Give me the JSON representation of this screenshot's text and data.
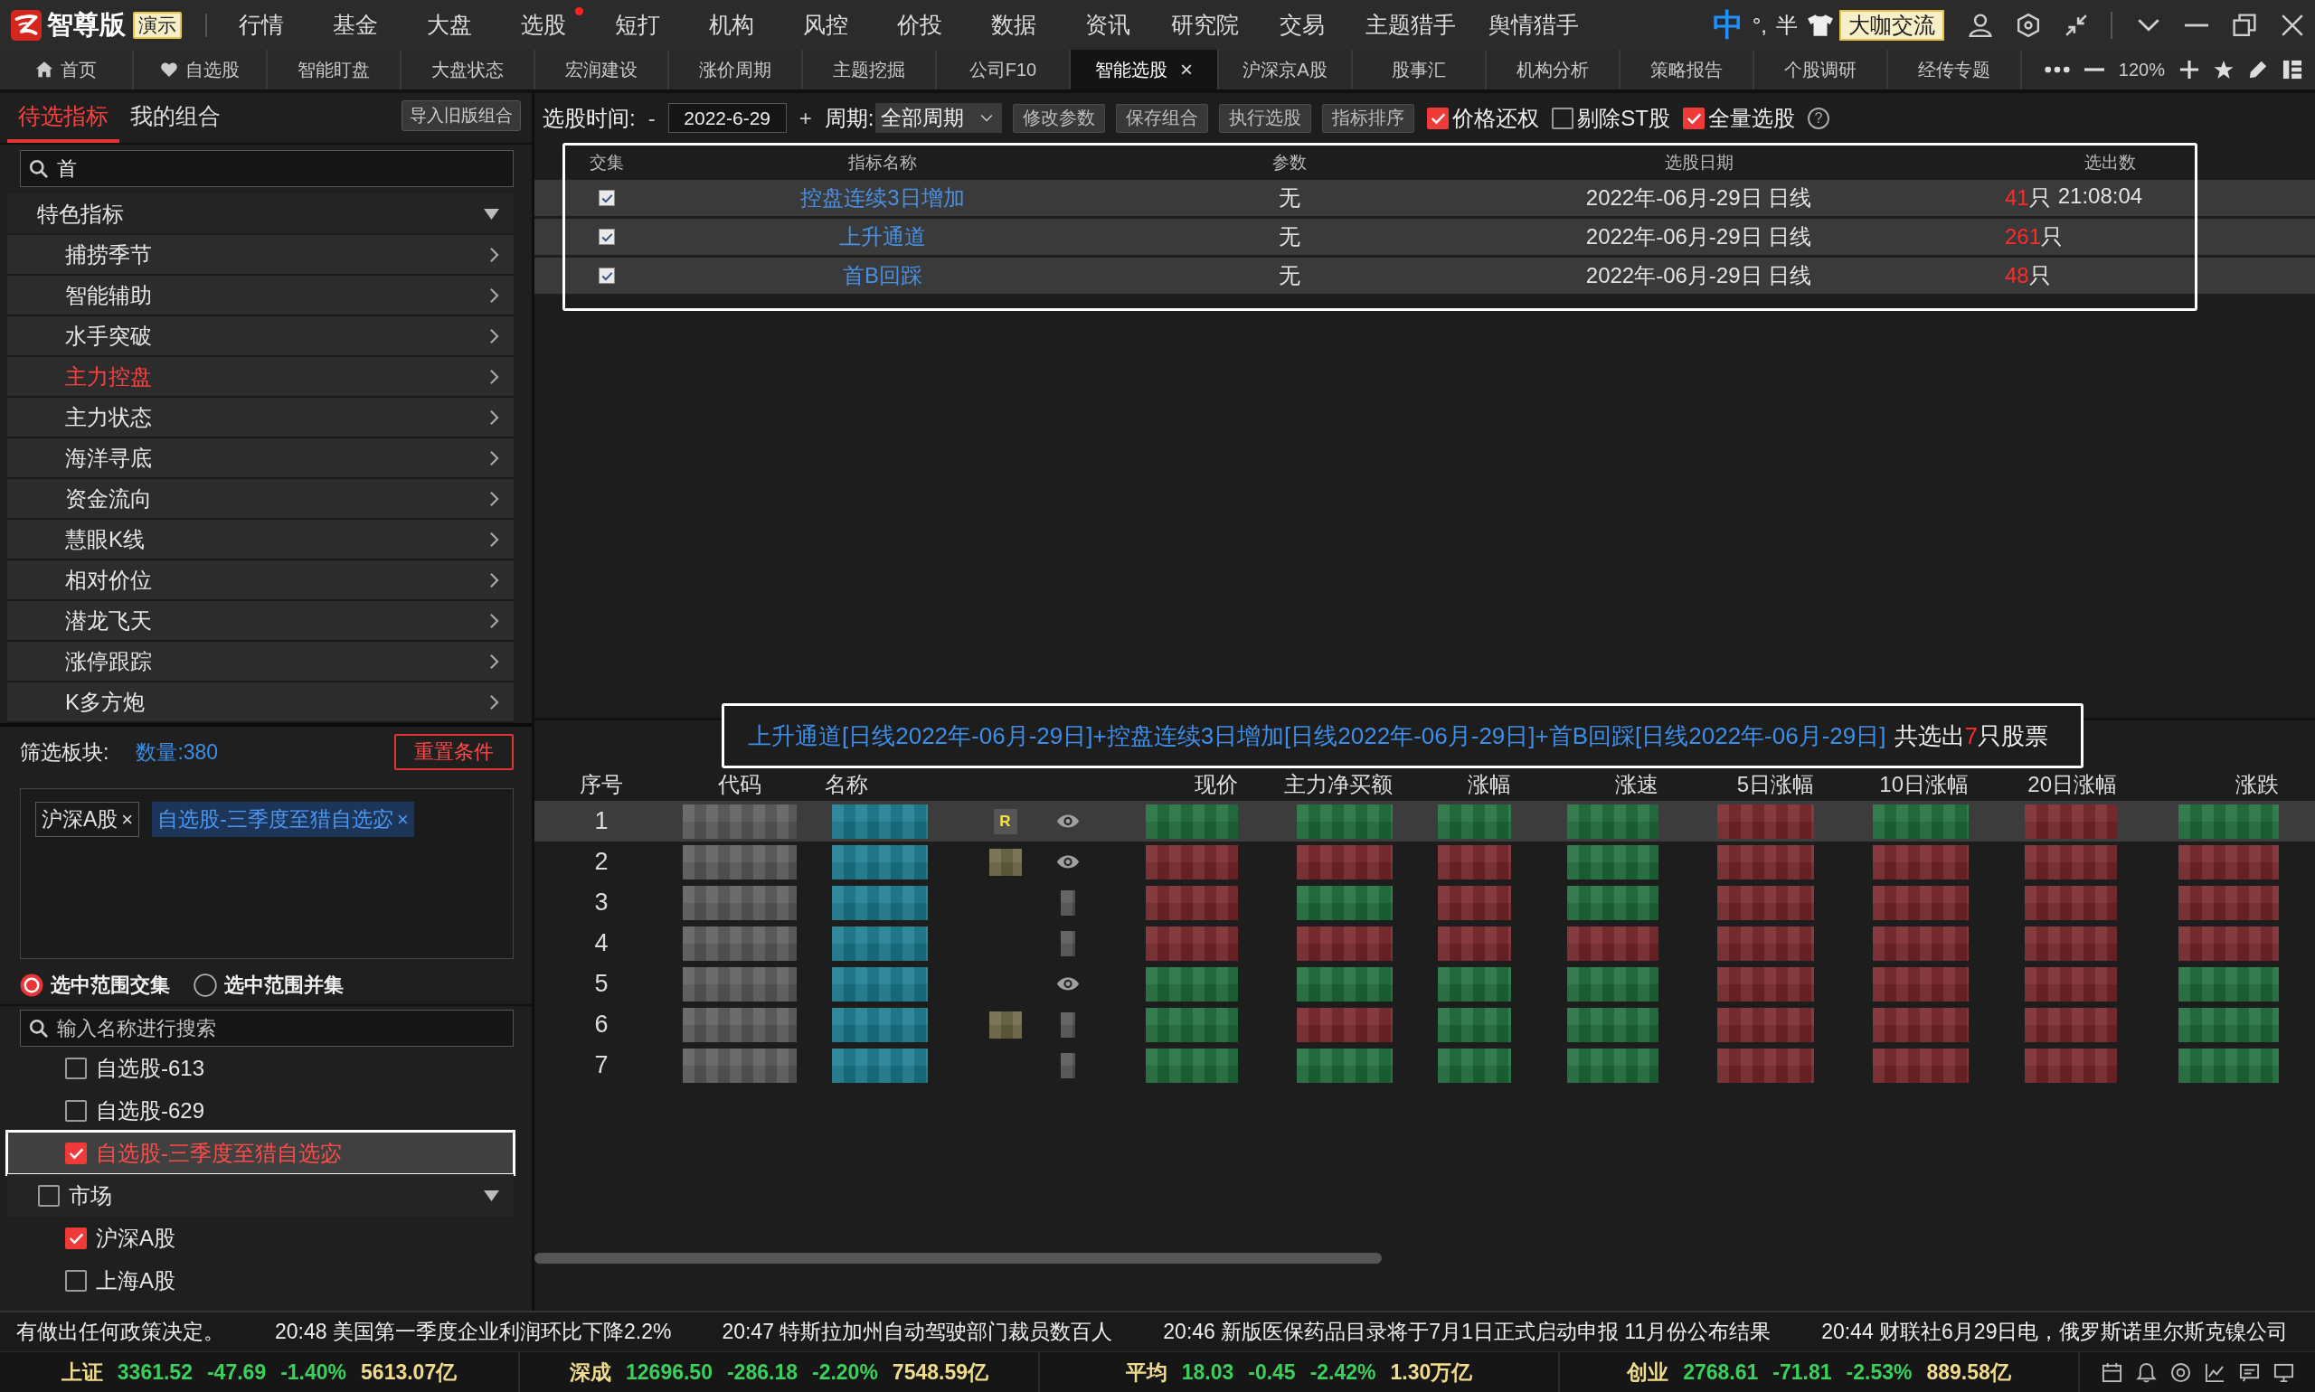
{
  "title_bar": {
    "logo_text": "智尊版",
    "edition_badge": "演示",
    "menu": [
      {
        "label": "行情",
        "dot": false
      },
      {
        "label": "基金",
        "dot": false
      },
      {
        "label": "大盘",
        "dot": false
      },
      {
        "label": "选股",
        "dot": true
      },
      {
        "label": "短打",
        "dot": false
      },
      {
        "label": "机构",
        "dot": false
      },
      {
        "label": "风控",
        "dot": false
      },
      {
        "label": "价投",
        "dot": false
      },
      {
        "label": "数据",
        "dot": false
      },
      {
        "label": "资讯",
        "dot": false
      },
      {
        "label": "研究院",
        "dot": false
      },
      {
        "label": "交易",
        "dot": false
      },
      {
        "label": "主题猎手",
        "dot": false
      },
      {
        "label": "舆情猎手",
        "dot": false
      }
    ],
    "ime": {
      "mode": "中",
      "punctuation": "°,",
      "width": "半"
    },
    "community_button": "大咖交流"
  },
  "tabs": [
    {
      "label": "首页",
      "kind": "home",
      "selected": false
    },
    {
      "label": "自选股",
      "kind": "favorites",
      "selected": false
    },
    {
      "label": "智能盯盘",
      "kind": "page",
      "selected": false
    },
    {
      "label": "大盘状态",
      "kind": "page",
      "selected": false
    },
    {
      "label": "宏润建设",
      "kind": "page",
      "selected": false
    },
    {
      "label": "涨价周期",
      "kind": "page",
      "selected": false
    },
    {
      "label": "主题挖掘",
      "kind": "page",
      "selected": false
    },
    {
      "label": "公司F10",
      "kind": "page",
      "selected": false
    },
    {
      "label": "智能选股",
      "kind": "page",
      "selected": true,
      "close": "×"
    },
    {
      "label": "沪深京A股",
      "kind": "page",
      "selected": false
    },
    {
      "label": "股事汇",
      "kind": "page",
      "selected": false
    },
    {
      "label": "机构分析",
      "kind": "page",
      "selected": false
    },
    {
      "label": "策略报告",
      "kind": "page",
      "selected": false
    },
    {
      "label": "个股调研",
      "kind": "page",
      "selected": false
    },
    {
      "label": "经传专题",
      "kind": "page",
      "selected": false
    }
  ],
  "tab_tools": {
    "zoom": "120%"
  },
  "sidebar": {
    "tabs": [
      {
        "label": "待选指标",
        "selected": true
      },
      {
        "label": "我的组合",
        "selected": false
      }
    ],
    "import_button": "导入旧版组合",
    "search": {
      "value": "首"
    },
    "indicator_tree": [
      {
        "label": "特色指标",
        "expanded": true,
        "children": [
          {
            "label": "捕捞季节",
            "selected": false
          },
          {
            "label": "智能辅助",
            "selected": false
          },
          {
            "label": "水手突破",
            "selected": false
          },
          {
            "label": "主力控盘",
            "selected": true
          },
          {
            "label": "主力状态",
            "selected": false
          },
          {
            "label": "海洋寻底",
            "selected": false
          },
          {
            "label": "资金流向",
            "selected": false
          },
          {
            "label": "慧眼K线",
            "selected": false
          },
          {
            "label": "相对价位",
            "selected": false
          },
          {
            "label": "潜龙飞天",
            "selected": false
          },
          {
            "label": "涨停跟踪",
            "selected": false
          },
          {
            "label": "K多方炮",
            "selected": false
          }
        ]
      }
    ],
    "filter": {
      "label": "筛选板块:",
      "count": "数量:380",
      "reset_button": "重置条件",
      "tags": [
        {
          "label": "沪深A股",
          "kind": "plain",
          "remove": "×"
        },
        {
          "label": "自选股-三季度至猎自选宓",
          "kind": "highlight",
          "remove": "×"
        }
      ]
    },
    "range_modes": [
      {
        "label": "选中范围交集",
        "selected": true
      },
      {
        "label": "选中范围并集",
        "selected": false
      }
    ],
    "board_search": {
      "placeholder": "输入名称进行搜索"
    },
    "board_tree": [
      {
        "children": [
          {
            "label": "自选股-613",
            "checked": false,
            "selected": false
          },
          {
            "label": "自选股-629",
            "checked": false,
            "selected": false
          },
          {
            "label": "自选股-三季度至猎自选宓",
            "checked": true,
            "selected": true
          }
        ]
      },
      {
        "label": "市场",
        "checked": false,
        "expanded": true,
        "children": [
          {
            "label": "沪深A股",
            "checked": true,
            "selected": false
          },
          {
            "label": "上海A股",
            "checked": false,
            "selected": false
          }
        ]
      }
    ]
  },
  "toolbar": {
    "time_label": "选股时间:",
    "minus": "-",
    "date": "2022-6-29",
    "plus": "+",
    "period_label": "周期:",
    "period": "全部周期",
    "buttons": [
      "修改参数",
      "保存组合",
      "执行选股",
      "指标排序"
    ],
    "options": [
      {
        "label": "价格还权",
        "checked": true
      },
      {
        "label": "剔除ST股",
        "checked": false
      },
      {
        "label": "全量选股",
        "checked": true
      }
    ],
    "help": "?"
  },
  "indicator_table": {
    "columns": [
      "交集",
      "指标名称",
      "参数",
      "选股日期",
      "选出数"
    ],
    "rows": [
      {
        "checked": true,
        "name": "控盘连续3日增加",
        "params": "无",
        "date": "2022年-06月-29日 日线",
        "count": "41",
        "unit": "只",
        "time": "21:08:04"
      },
      {
        "checked": true,
        "name": "上升通道",
        "params": "无",
        "date": "2022年-06月-29日 日线",
        "count": "261",
        "unit": "只"
      },
      {
        "checked": true,
        "name": "首B回踩",
        "params": "无",
        "date": "2022年-06月-29日 日线",
        "count": "48",
        "unit": "只"
      }
    ]
  },
  "summary": {
    "formula": "上升通道[日线2022年-06月-29日]+控盘连续3日增加[日线2022年-06月-29日]+首B回踩[日线2022年-06月-29日]",
    "result_prefix": "共选出",
    "count": "7",
    "result_suffix": "只股票"
  },
  "results_table": {
    "columns": [
      {
        "label": "序号",
        "kind": "index"
      },
      {
        "label": "代码",
        "kind": "code"
      },
      {
        "label": "名称",
        "kind": "name"
      },
      {
        "kind": "badge"
      },
      {
        "kind": "watch"
      },
      {
        "label": "现价",
        "kind": "value"
      },
      {
        "label": "主力净买额",
        "kind": "value"
      },
      {
        "label": "涨幅",
        "kind": "value"
      },
      {
        "label": "涨速",
        "kind": "value"
      },
      {
        "label": "5日涨幅",
        "kind": "value"
      },
      {
        "label": "10日涨幅",
        "kind": "value"
      },
      {
        "label": "20日涨幅",
        "kind": "value"
      },
      {
        "label": "涨跌",
        "kind": "value"
      }
    ],
    "rows": [
      {
        "index": "1",
        "selected": true,
        "badge": {
          "kind": "letter",
          "text": "R"
        },
        "watched": true,
        "values": [
          {
            "color": "#1f6e3c"
          },
          {
            "color": "#1f6e3c"
          },
          {
            "color": "#1f6e3c"
          },
          {
            "color": "#1f6e3c"
          },
          {
            "color": "#7a272b"
          },
          {
            "color": "#1f6e3c"
          },
          {
            "color": "#7a272b"
          },
          {
            "color": "#1f6e3c"
          }
        ]
      },
      {
        "index": "2",
        "selected": false,
        "badge": {
          "kind": "pixelated"
        },
        "watched": true,
        "values": [
          {
            "color": "#7a272b"
          },
          {
            "color": "#7a272b"
          },
          {
            "color": "#7a272b"
          },
          {
            "color": "#1f6e3c"
          },
          {
            "color": "#7a272b"
          },
          {
            "color": "#7a272b"
          },
          {
            "color": "#7a272b"
          },
          {
            "color": "#7a272b"
          }
        ]
      },
      {
        "index": "3",
        "selected": false,
        "badge": {
          "kind": "none"
        },
        "watched": false,
        "values": [
          {
            "color": "#7a272b"
          },
          {
            "color": "#1f6e3c"
          },
          {
            "color": "#7a272b"
          },
          {
            "color": "#1f6e3c"
          },
          {
            "color": "#7a272b"
          },
          {
            "color": "#7a272b"
          },
          {
            "color": "#7a272b"
          },
          {
            "color": "#7a272b"
          }
        ]
      },
      {
        "index": "4",
        "selected": false,
        "badge": {
          "kind": "none"
        },
        "watched": false,
        "values": [
          {
            "color": "#7a272b"
          },
          {
            "color": "#7a272b"
          },
          {
            "color": "#7a272b"
          },
          {
            "color": "#7a272b"
          },
          {
            "color": "#7a272b"
          },
          {
            "color": "#7a272b"
          },
          {
            "color": "#7a272b"
          },
          {
            "color": "#7a272b"
          }
        ]
      },
      {
        "index": "5",
        "selected": false,
        "badge": {
          "kind": "none"
        },
        "watched": true,
        "values": [
          {
            "color": "#1f6e3c"
          },
          {
            "color": "#1f6e3c"
          },
          {
            "color": "#1f6e3c"
          },
          {
            "color": "#1f6e3c"
          },
          {
            "color": "#7a272b"
          },
          {
            "color": "#7a272b"
          },
          {
            "color": "#7a272b"
          },
          {
            "color": "#1f6e3c"
          }
        ]
      },
      {
        "index": "6",
        "selected": false,
        "badge": {
          "kind": "pixelated"
        },
        "watched": false,
        "values": [
          {
            "color": "#1f6e3c"
          },
          {
            "color": "#7a272b"
          },
          {
            "color": "#1f6e3c"
          },
          {
            "color": "#1f6e3c"
          },
          {
            "color": "#7a272b"
          },
          {
            "color": "#7a272b"
          },
          {
            "color": "#7a272b"
          },
          {
            "color": "#1f6e3c"
          }
        ]
      },
      {
        "index": "7",
        "selected": false,
        "badge": {
          "kind": "none"
        },
        "watched": false,
        "values": [
          {
            "color": "#1f6e3c"
          },
          {
            "color": "#1f6e3c"
          },
          {
            "color": "#1f6e3c"
          },
          {
            "color": "#1f6e3c"
          },
          {
            "color": "#7a272b"
          },
          {
            "color": "#7a272b"
          },
          {
            "color": "#7a272b"
          },
          {
            "color": "#1f6e3c"
          }
        ]
      }
    ]
  },
  "news_ticker": [
    "有做出任何政策决定。",
    "20:48 美国第一季度企业利润环比下降2.2%",
    "20:47 特斯拉加州自动驾驶部门裁员数百人",
    "20:46 新版医保药品目录将于7月1日正式启动申报 11月份公布结果",
    "20:44 财联社6月29日电，俄罗斯诺里尔斯克镍公司"
  ],
  "index_bar": [
    {
      "name": "上证",
      "price": "3361.52",
      "change": "-47.69",
      "percent": "-1.40%",
      "turnover": "5613.07亿",
      "rising": false
    },
    {
      "name": "深成",
      "price": "12696.50",
      "change": "-286.18",
      "percent": "-2.20%",
      "turnover": "7548.59亿",
      "rising": false
    },
    {
      "name": "平均",
      "price": "18.03",
      "change": "-0.45",
      "percent": "-2.42%",
      "turnover": "1.30万亿",
      "rising": false
    },
    {
      "name": "创业",
      "price": "2768.61",
      "change": "-71.81",
      "percent": "-2.53%",
      "turnover": "889.58亿",
      "rising": false
    }
  ]
}
